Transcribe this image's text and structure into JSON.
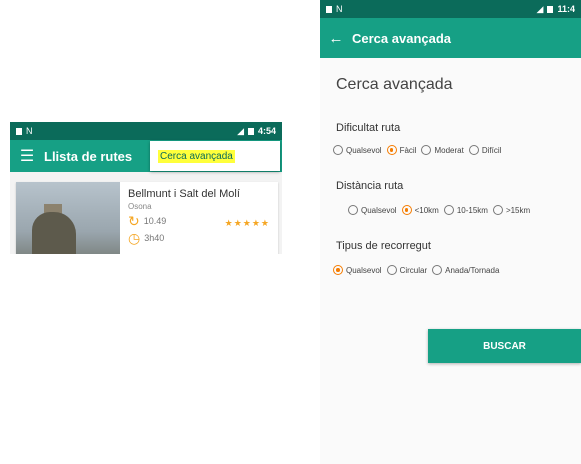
{
  "left": {
    "status_time": "4:54",
    "toolbar_title": "Llista de rutes",
    "menu_popup": "Cerca avançada",
    "card": {
      "title": "Bellmunt i Salt del Molí",
      "region": "Osona",
      "distance": "10.49",
      "duration": "3h40",
      "rating": "★★★★★"
    }
  },
  "right": {
    "status_time": "11:4",
    "toolbar_title": "Cerca avançada",
    "page_title": "Cerca avançada",
    "difficulty": {
      "label": "Dificultat ruta",
      "options": [
        "Qualsevol",
        "Fàcil",
        "Moderat",
        "Difícil"
      ],
      "selected": "Fàcil"
    },
    "distance": {
      "label": "Distància ruta",
      "options": [
        "Qualsevol",
        "<10km",
        "10-15km",
        ">15km"
      ],
      "selected": "<10km"
    },
    "route_type": {
      "label": "Tipus de recorregut",
      "options": [
        "Qualsevol",
        "Circular",
        "Anada/Tornada"
      ],
      "selected": "Qualsevol"
    },
    "search_button": "BUSCAR"
  },
  "colors": {
    "status_bar": "#0b6b5a",
    "toolbar": "#16a085",
    "accent": "#f57c00",
    "highlight": "#ffff3b"
  }
}
